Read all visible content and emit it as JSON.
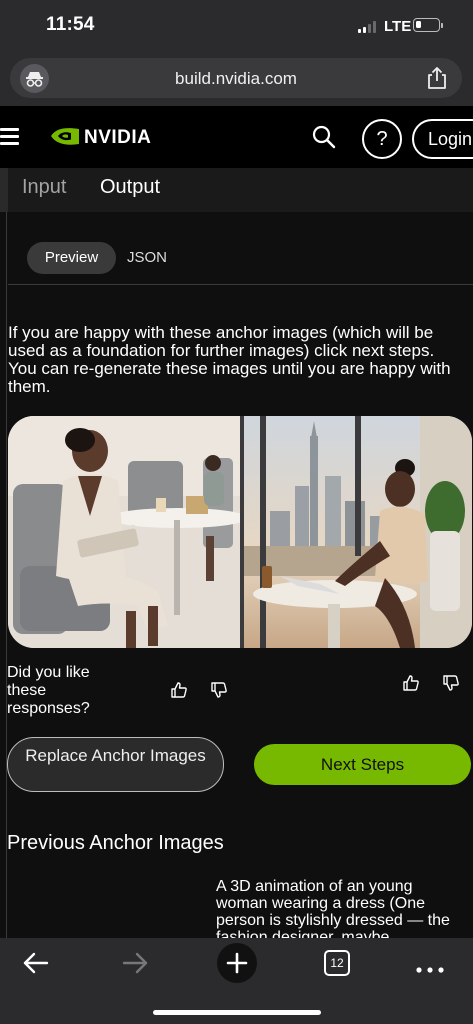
{
  "status_bar": {
    "time": "11:54",
    "network": "LTE",
    "battery_level": 0.25
  },
  "browser": {
    "url": "build.nvidia.com",
    "tab_count": "12"
  },
  "header": {
    "brand": "NVIDIA",
    "help_label": "?",
    "login_label": "Login"
  },
  "tabs": [
    {
      "label": "Input"
    },
    {
      "label": "Output"
    }
  ],
  "view_toggle": {
    "preview": "Preview",
    "json": "JSON"
  },
  "intro_text": "If you are happy with these anchor images (which will be used as a foundation for further images) click next steps. You can re-generate these images until you are happy with them.",
  "feedback": {
    "question": "Did you like these responses?"
  },
  "buttons": {
    "replace": "Replace Anchor Images",
    "next": "Next Steps"
  },
  "previous": {
    "title": "Previous Anchor Images",
    "description": "A 3D animation of an young woman wearing a dress (One person is stylishly dressed — the fashion designer, maybe"
  },
  "colors": {
    "accent": "#76b900",
    "page_bg": "#0f0f0f",
    "chrome": "#2b2b2e"
  },
  "icons": [
    "privacy-icon",
    "share-icon",
    "menu-icon",
    "nvidia-logo-icon",
    "search-icon",
    "thumbs-up-icon",
    "thumbs-down-icon",
    "back-icon",
    "forward-icon",
    "new-tab-icon",
    "tabs-icon",
    "more-icon"
  ]
}
